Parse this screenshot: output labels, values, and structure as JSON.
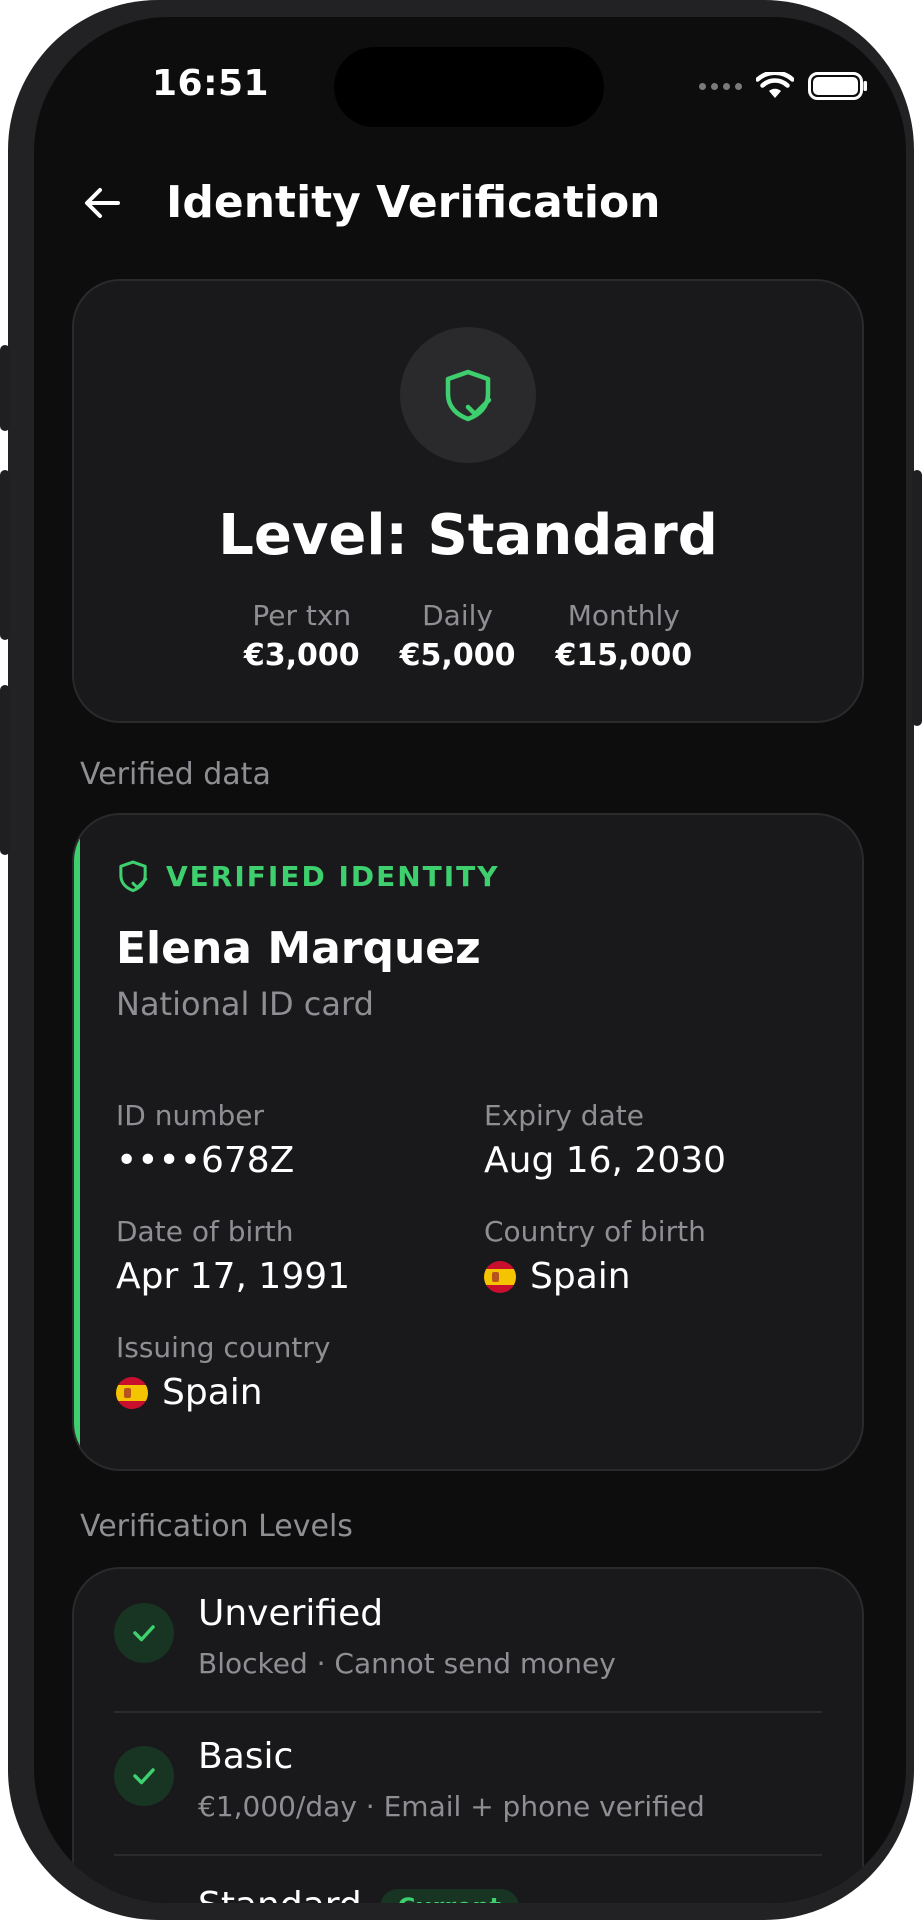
{
  "status": {
    "time": "16:51"
  },
  "header": {
    "title": "Identity Verification"
  },
  "level_card": {
    "title": "Level: Standard",
    "limits": [
      {
        "label": "Per txn",
        "value": "€3,000"
      },
      {
        "label": "Daily",
        "value": "€5,000"
      },
      {
        "label": "Monthly",
        "value": "€15,000"
      }
    ]
  },
  "sections": {
    "verified_data": "Verified data",
    "verification_levels": "Verification Levels"
  },
  "identity": {
    "badge": "VERIFIED IDENTITY",
    "name": "Elena Marquez",
    "document": "National ID card",
    "fields": {
      "id_number": {
        "label": "ID number",
        "value": "••••678Z"
      },
      "expiry": {
        "label": "Expiry date",
        "value": "Aug 16, 2030"
      },
      "dob": {
        "label": "Date of birth",
        "value": "Apr 17, 1991"
      },
      "country_birth": {
        "label": "Country of birth",
        "value": "Spain"
      },
      "issuing_country": {
        "label": "Issuing country",
        "value": "Spain"
      }
    }
  },
  "levels": [
    {
      "name": "Unverified",
      "desc": "Blocked · Cannot send money"
    },
    {
      "name": "Basic",
      "desc": "€1,000/day · Email + phone verified"
    },
    {
      "name": "Standard",
      "badge": "Current"
    }
  ],
  "colors": {
    "accent": "#3ecf6e",
    "background": "#0d0d0e",
    "card": "#19191b"
  }
}
